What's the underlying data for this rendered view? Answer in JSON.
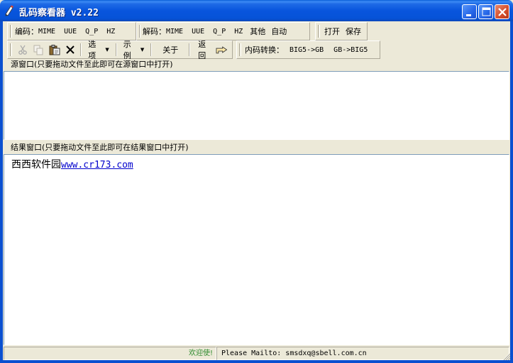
{
  "window": {
    "title": "乱码察看器 v2.22"
  },
  "toolbar1": {
    "encode_label": "编码：",
    "encode_buttons": [
      "MIME",
      "UUE",
      "Q_P",
      "HZ"
    ],
    "decode_label": "解码：",
    "decode_buttons": [
      "MIME",
      "UUE",
      "Q_P",
      "HZ"
    ],
    "other": "其他",
    "auto": "自动",
    "open": "打开",
    "save": "保存"
  },
  "toolbar2": {
    "options": "选项",
    "examples": "示例",
    "about": "关于",
    "back": "返回",
    "convert_label": "内码转换：",
    "big5_to_gb": "BIG5->GB",
    "gb_to_big5": "GB->BIG5",
    "icons": [
      "cut-icon",
      "copy-icon",
      "paste-icon",
      "delete-icon",
      "hand-pointer-icon"
    ]
  },
  "source_pane": {
    "caption": "源窗口(只要拖动文件至此即可在源窗口中打开)",
    "content": ""
  },
  "result_pane": {
    "caption": "结果窗口(只要拖动文件至此即可在结果窗口中打开)",
    "text": "西西软件园",
    "link": "www.cr173.com"
  },
  "status": {
    "welcome": "欢迎使!",
    "mail": "Please Mailto: smsdxq@sbell.com.cn"
  },
  "colors": {
    "titlebar": "#0855DD",
    "face": "#ECE9D8",
    "link": "#0000CC",
    "welcome": "#2E8B2E"
  }
}
